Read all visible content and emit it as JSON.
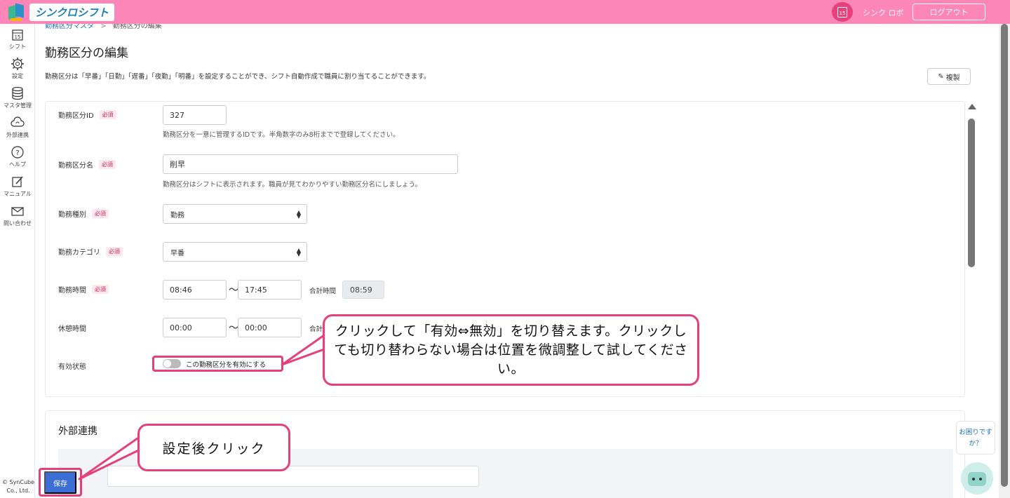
{
  "app": {
    "logo_text": "シンクロシフト",
    "user_name": "シンク ロボ",
    "logout_label": "ログアウト",
    "calendar_day": "15"
  },
  "sidebar": {
    "items": [
      {
        "label": "シフト",
        "icon": "calendar-icon"
      },
      {
        "label": "設定",
        "icon": "gear-icon"
      },
      {
        "label": "マスタ管理",
        "icon": "database-icon"
      },
      {
        "label": "外部連携",
        "icon": "cloud-sync-icon"
      },
      {
        "label": "ヘルプ",
        "icon": "help-icon"
      },
      {
        "label": "マニュアル",
        "icon": "edit-icon"
      },
      {
        "label": "問い合わせ",
        "icon": "mail-icon"
      }
    ],
    "copyright": "© SynCube Co., Ltd."
  },
  "breadcrumb": {
    "parent": "勤務区分マスタ",
    "sep": ">",
    "current": "勤務区分の編集"
  },
  "page": {
    "title": "勤務区分の編集",
    "description": "勤務区分は「早番」「日勤」「遅番」「夜勤」「明番」を設定することができ、シフト自動作成で職員に割り当てることができます。",
    "copy_label": "複製"
  },
  "form": {
    "required_badge": "必須",
    "id": {
      "label": "勤務区分ID",
      "value": "327",
      "help": "勤務区分を一意に管理するIDです。半角数字のみ8桁までで登録してください。"
    },
    "name": {
      "label": "勤務区分名",
      "value": "削早",
      "help": "勤務区分はシフトに表示されます。職員が見てわかりやすい勤務区分名にしましょう。"
    },
    "type": {
      "label": "勤務種別",
      "value": "勤務"
    },
    "category": {
      "label": "勤務カテゴリ",
      "value": "早番"
    },
    "work_time": {
      "label": "勤務時間",
      "start": "08:46",
      "end": "17:45",
      "sum_label": "合計時間",
      "sum": "08:59"
    },
    "break_time": {
      "label": "休憩時間",
      "start": "00:00",
      "end": "00:00",
      "sum_label": "合計"
    },
    "tilde": "〜",
    "status": {
      "label": "有効状態",
      "toggle_label": "この勤務区分を有効にする",
      "enabled": false
    }
  },
  "external": {
    "title": "外部連携"
  },
  "save_label": "保存",
  "callouts": {
    "toggle_hint": "クリックして「有効⇔無効」を切り替えます。クリックしても切り替わらない場合は位置を微調整して試してください。",
    "save_hint": "設定後クリック"
  },
  "help_widget": {
    "text": "お困りですか？"
  },
  "colors": {
    "header": "#fc86b8",
    "accent": "#e4407c",
    "primary": "#3b6fd6"
  }
}
